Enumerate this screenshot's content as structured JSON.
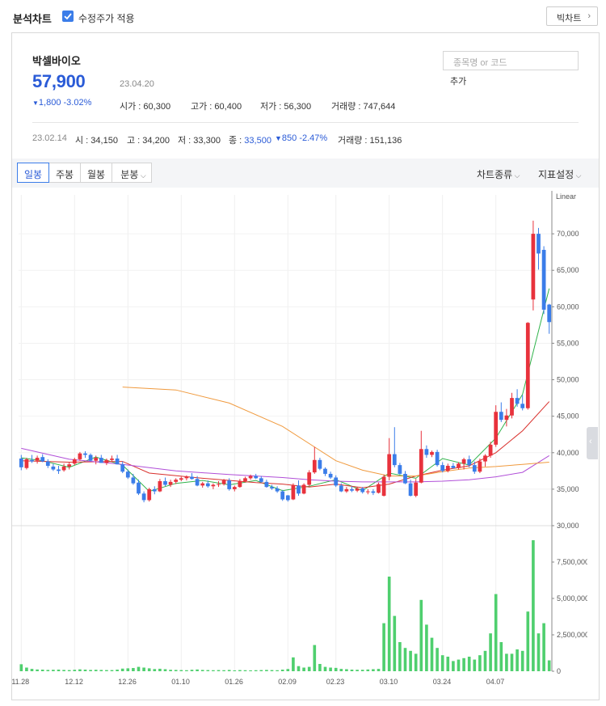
{
  "header": {
    "title": "분석차트",
    "adjusted_label": "수정주가 적용",
    "big_chart_label": "빅차트"
  },
  "quote": {
    "name": "박셀바이오",
    "price": "57,900",
    "date": "23.04.20",
    "change": "1,800 -3.02%",
    "open_label": "시가",
    "open": "60,300",
    "high_label": "고가",
    "high": "60,400",
    "low_label": "저가",
    "low": "56,300",
    "volume_label": "거래량",
    "volume": "747,644"
  },
  "search": {
    "placeholder": "종목명 or 코드",
    "add_label": "추가"
  },
  "day_info": {
    "date": "23.02.14",
    "open_label": "시",
    "open": "34,150",
    "high_label": "고",
    "high": "34,200",
    "low_label": "저",
    "low": "33,300",
    "close_label": "종",
    "close": "33,500",
    "change": "850 -2.47%",
    "volume_label": "거래량",
    "volume": "151,136"
  },
  "toolbar": {
    "tabs": [
      "일봉",
      "주봉",
      "월봉",
      "분봉"
    ],
    "chart_type_label": "차트종류",
    "indicator_label": "지표설정"
  },
  "colors": {
    "up": "#e8323c",
    "down": "#3b7de9",
    "volume": "#4fcf6e",
    "ma5": "#2fb34a",
    "ma20": "#d9302c",
    "ma60": "#b14fd8",
    "ma120": "#f09a3e",
    "accent": "#2a5bd7"
  },
  "chart_data": {
    "type": "candlestick",
    "scale": "Linear",
    "price_ylim": [
      30000,
      75000
    ],
    "price_ticks": [
      "70,000",
      "65,000",
      "60,000",
      "55,000",
      "50,000",
      "45,000",
      "40,000",
      "35,000",
      "30,000"
    ],
    "price_tick_values": [
      70000,
      65000,
      60000,
      55000,
      50000,
      45000,
      40000,
      35000,
      30000
    ],
    "volume_ylim": [
      0,
      10000000
    ],
    "volume_ticks": [
      "7,500,000",
      "5,000,000",
      "2,500,000",
      "0"
    ],
    "volume_tick_values": [
      7500000,
      5000000,
      2500000,
      0
    ],
    "x_labels": [
      "11.28",
      "12.12",
      "12.26",
      "01.10",
      "01.26",
      "02.09",
      "02.23",
      "03.10",
      "03.24",
      "04.07"
    ],
    "x_label_index": [
      0,
      10,
      20,
      30,
      40,
      50,
      59,
      69,
      79,
      89
    ],
    "candles": [
      [
        39200,
        39700,
        37600,
        38000,
        480000
      ],
      [
        37900,
        39300,
        37700,
        39100,
        250000
      ],
      [
        39000,
        39700,
        38600,
        38800,
        160000
      ],
      [
        38900,
        39600,
        38500,
        39300,
        120000
      ],
      [
        39400,
        39800,
        38700,
        38800,
        110000
      ],
      [
        38800,
        39100,
        37900,
        38200,
        90000
      ],
      [
        38100,
        38500,
        37500,
        37700,
        100000
      ],
      [
        37700,
        38200,
        37100,
        37500,
        110000
      ],
      [
        37600,
        38500,
        37400,
        38100,
        90000
      ],
      [
        38100,
        38700,
        37700,
        38400,
        80000
      ],
      [
        38500,
        39300,
        38300,
        39100,
        100000
      ],
      [
        39100,
        40100,
        38900,
        39900,
        130000
      ],
      [
        39900,
        40200,
        39300,
        39700,
        110000
      ],
      [
        39700,
        39900,
        38800,
        38900,
        90000
      ],
      [
        38900,
        39600,
        38400,
        39300,
        100000
      ],
      [
        39300,
        39700,
        38600,
        38600,
        90000
      ],
      [
        38600,
        39200,
        38300,
        39000,
        80000
      ],
      [
        39000,
        39600,
        38700,
        39200,
        80000
      ],
      [
        39200,
        39700,
        38400,
        38400,
        110000
      ],
      [
        38400,
        38800,
        37200,
        37400,
        180000
      ],
      [
        37400,
        37700,
        36400,
        36600,
        200000
      ],
      [
        36600,
        37100,
        35600,
        35800,
        220000
      ],
      [
        35900,
        36300,
        34200,
        34400,
        300000
      ],
      [
        34400,
        34700,
        33200,
        33500,
        250000
      ],
      [
        33500,
        35200,
        33300,
        35000,
        200000
      ],
      [
        35000,
        35400,
        34300,
        34700,
        150000
      ],
      [
        34700,
        36400,
        34600,
        36100,
        170000
      ],
      [
        36100,
        36600,
        35400,
        35600,
        140000
      ],
      [
        35600,
        36300,
        35300,
        36000,
        100000
      ],
      [
        36000,
        36500,
        35700,
        36300,
        90000
      ],
      [
        36300,
        36700,
        36100,
        36500,
        80000
      ],
      [
        36500,
        36900,
        36200,
        36700,
        70000
      ],
      [
        36700,
        37200,
        36300,
        36400,
        100000
      ],
      [
        36400,
        36800,
        35400,
        35500,
        120000
      ],
      [
        35500,
        36000,
        35200,
        35800,
        90000
      ],
      [
        35800,
        36200,
        35200,
        35400,
        80000
      ],
      [
        35400,
        35800,
        35000,
        35600,
        70000
      ],
      [
        35600,
        36100,
        35300,
        35700,
        80000
      ],
      [
        35700,
        36400,
        35500,
        36200,
        70000
      ],
      [
        36200,
        36500,
        34800,
        35000,
        90000
      ],
      [
        35000,
        35500,
        34700,
        35300,
        60000
      ],
      [
        35300,
        36400,
        35200,
        36100,
        80000
      ],
      [
        36100,
        36700,
        35900,
        36500,
        70000
      ],
      [
        36500,
        37000,
        36300,
        36800,
        60000
      ],
      [
        36800,
        37100,
        36400,
        36500,
        70000
      ],
      [
        36500,
        36800,
        35900,
        36000,
        80000
      ],
      [
        36000,
        36300,
        35200,
        35300,
        90000
      ],
      [
        35300,
        35600,
        34900,
        35100,
        80000
      ],
      [
        35100,
        35400,
        34500,
        34700,
        70000
      ],
      [
        34700,
        34900,
        33400,
        33600,
        110000
      ],
      [
        34150,
        34200,
        33300,
        33500,
        151136
      ],
      [
        33600,
        35800,
        33500,
        35500,
        950000
      ],
      [
        35500,
        36200,
        34100,
        34400,
        350000
      ],
      [
        34400,
        35800,
        34300,
        35600,
        250000
      ],
      [
        35600,
        37600,
        35400,
        37300,
        300000
      ],
      [
        37300,
        40800,
        37100,
        39000,
        1800000
      ],
      [
        39000,
        39300,
        37600,
        37800,
        500000
      ],
      [
        37800,
        38000,
        36800,
        37100,
        300000
      ],
      [
        37100,
        37400,
        36400,
        36600,
        250000
      ],
      [
        36600,
        36900,
        35300,
        35500,
        230000
      ],
      [
        35500,
        35800,
        34600,
        34700,
        160000
      ],
      [
        34700,
        35300,
        34500,
        35000,
        140000
      ],
      [
        35000,
        35400,
        34600,
        34800,
        110000
      ],
      [
        34800,
        35300,
        34600,
        35100,
        100000
      ],
      [
        35100,
        35300,
        34400,
        34600,
        100000
      ],
      [
        34600,
        35000,
        34300,
        34700,
        120000
      ],
      [
        34700,
        35000,
        34200,
        34500,
        140000
      ],
      [
        34500,
        35900,
        34400,
        35700,
        160000
      ],
      [
        34100,
        37000,
        34000,
        36700,
        3300000
      ],
      [
        36700,
        42000,
        36200,
        39800,
        6500000
      ],
      [
        39800,
        43500,
        38000,
        38300,
        3800000
      ],
      [
        38300,
        38600,
        37000,
        37100,
        2000000
      ],
      [
        37100,
        37500,
        35700,
        35800,
        1600000
      ],
      [
        35800,
        36300,
        34000,
        34100,
        1400000
      ],
      [
        34100,
        36400,
        33900,
        35900,
        1200000
      ],
      [
        35900,
        43000,
        35800,
        40500,
        4900000
      ],
      [
        40500,
        41000,
        39300,
        39700,
        3200000
      ],
      [
        39700,
        40300,
        39400,
        40100,
        2300000
      ],
      [
        40100,
        40400,
        38100,
        38300,
        1600000
      ],
      [
        38300,
        38700,
        37300,
        37500,
        1100000
      ],
      [
        37500,
        38500,
        37300,
        38200,
        1000000
      ],
      [
        38200,
        38600,
        37800,
        37900,
        700000
      ],
      [
        37900,
        38700,
        37700,
        38500,
        800000
      ],
      [
        38500,
        39300,
        37700,
        39100,
        900000
      ],
      [
        39100,
        39600,
        38000,
        38300,
        1000000
      ],
      [
        38300,
        38800,
        37100,
        37400,
        800000
      ],
      [
        37400,
        39200,
        37200,
        38800,
        1100000
      ],
      [
        38800,
        39800,
        38100,
        39600,
        1400000
      ],
      [
        39600,
        41500,
        39300,
        41100,
        2600000
      ],
      [
        41100,
        46500,
        40800,
        45600,
        5300000
      ],
      [
        45600,
        46900,
        44200,
        44500,
        2000000
      ],
      [
        44500,
        46000,
        43600,
        45100,
        1200000
      ],
      [
        45100,
        48200,
        44700,
        47500,
        1200000
      ],
      [
        47500,
        48700,
        46300,
        46700,
        1500000
      ],
      [
        46700,
        47900,
        45800,
        46100,
        1400000
      ],
      [
        46100,
        57900,
        45900,
        57800,
        4100000
      ],
      [
        61000,
        71800,
        59500,
        70000,
        9000000
      ],
      [
        70000,
        70800,
        65100,
        67300,
        2600000
      ],
      [
        67800,
        68300,
        59000,
        59600,
        3300000
      ],
      [
        60300,
        60400,
        56300,
        57900,
        747644
      ]
    ],
    "moving_averages": [
      {
        "name": "ma5",
        "start_index": 0,
        "points": [
          [
            0,
            39300
          ],
          [
            4,
            38900
          ],
          [
            9,
            38000
          ],
          [
            14,
            39400
          ],
          [
            19,
            38300
          ],
          [
            24,
            34700
          ],
          [
            29,
            35800
          ],
          [
            34,
            36200
          ],
          [
            39,
            35600
          ],
          [
            44,
            36200
          ],
          [
            49,
            34800
          ],
          [
            54,
            35400
          ],
          [
            59,
            36300
          ],
          [
            64,
            34800
          ],
          [
            69,
            37200
          ],
          [
            74,
            36500
          ],
          [
            79,
            39200
          ],
          [
            84,
            38300
          ],
          [
            89,
            42000
          ],
          [
            94,
            48000
          ],
          [
            99,
            62500
          ]
        ]
      },
      {
        "name": "ma20",
        "start_index": 0,
        "points": [
          [
            0,
            38900
          ],
          [
            9,
            38700
          ],
          [
            19,
            38800
          ],
          [
            24,
            37200
          ],
          [
            34,
            36500
          ],
          [
            44,
            35900
          ],
          [
            49,
            35700
          ],
          [
            54,
            35300
          ],
          [
            59,
            35700
          ],
          [
            64,
            35200
          ],
          [
            69,
            35700
          ],
          [
            74,
            36800
          ],
          [
            79,
            37600
          ],
          [
            84,
            38200
          ],
          [
            89,
            40000
          ],
          [
            94,
            43000
          ],
          [
            99,
            47000
          ]
        ]
      },
      {
        "name": "ma60",
        "start_index": 0,
        "points": [
          [
            0,
            40600
          ],
          [
            9,
            39100
          ],
          [
            19,
            38400
          ],
          [
            29,
            37500
          ],
          [
            39,
            37000
          ],
          [
            49,
            36600
          ],
          [
            54,
            36300
          ],
          [
            59,
            36100
          ],
          [
            64,
            36000
          ],
          [
            69,
            36000
          ],
          [
            74,
            36000
          ],
          [
            79,
            36100
          ],
          [
            84,
            36300
          ],
          [
            89,
            36700
          ],
          [
            94,
            37300
          ],
          [
            99,
            39600
          ]
        ]
      },
      {
        "name": "ma120",
        "start_index": 19,
        "points": [
          [
            19,
            49000
          ],
          [
            29,
            48600
          ],
          [
            39,
            46800
          ],
          [
            49,
            43600
          ],
          [
            59,
            38900
          ],
          [
            64,
            37600
          ],
          [
            69,
            36800
          ],
          [
            74,
            36800
          ],
          [
            79,
            37400
          ],
          [
            84,
            37900
          ],
          [
            89,
            38100
          ],
          [
            94,
            38400
          ],
          [
            99,
            38700
          ]
        ]
      }
    ]
  }
}
